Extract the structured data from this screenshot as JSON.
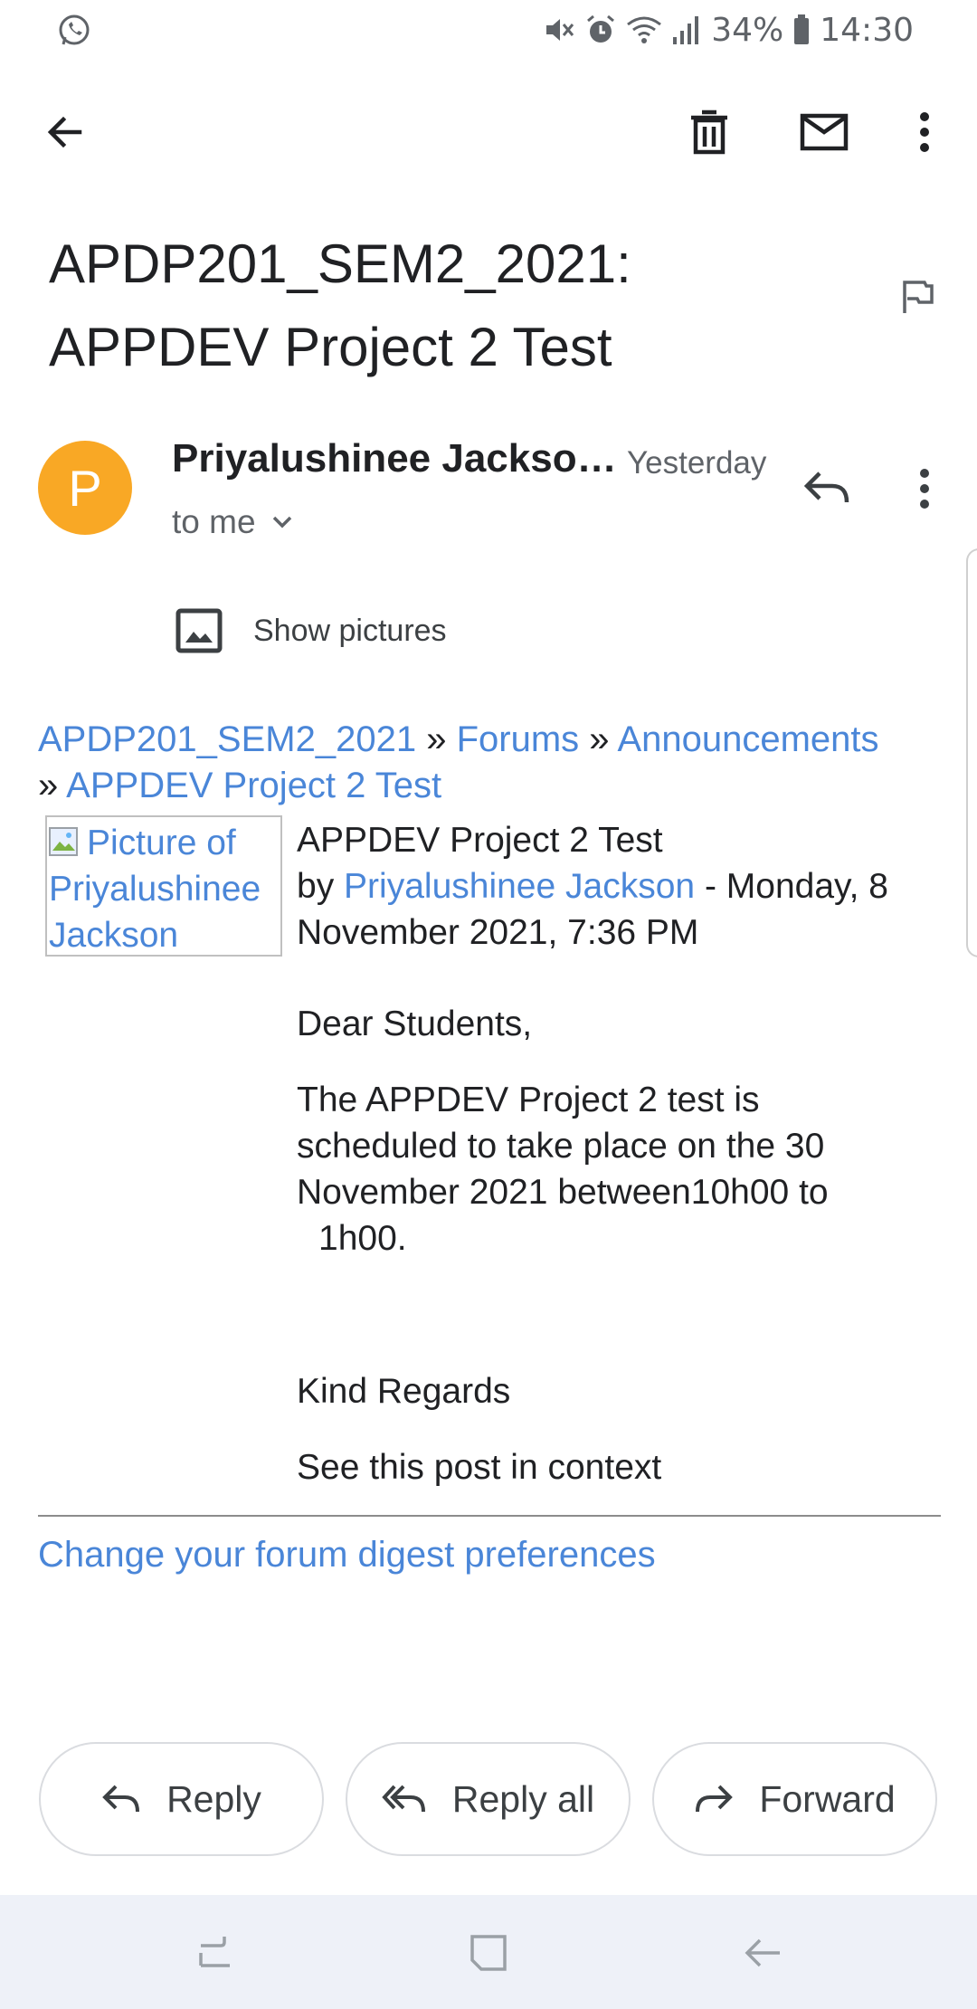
{
  "status": {
    "battery": "34%",
    "time": "14:30"
  },
  "email": {
    "subject": "APDP201_SEM2_2021: APPDEV Project 2 Test",
    "sender_initial": "P",
    "sender": "Priyalushinee Jackso…",
    "date": "Yesterday",
    "recipient": "to me",
    "show_pictures": "Show pictures"
  },
  "breadcrumb": {
    "course": "APDP201_SEM2_2021",
    "sep": "»",
    "forums": "Forums",
    "announcements": "Announcements",
    "topic": "APPDEV Project 2 Test"
  },
  "post": {
    "image_alt": "Picture of Priyalushinee Jackson",
    "title": "APPDEV Project 2 Test",
    "by": "by",
    "author": "Priyalushinee Jackson",
    "datetime": "- Monday, 8 November 2021, 7:36 PM",
    "greeting": "Dear Students,",
    "message": "The APPDEV Project 2 test is scheduled to take place on the 30 November 2021 between10h00 to",
    "message_tail": "1h00.",
    "closing": "Kind Regards",
    "context_link": "See this post in context",
    "prefs_link": "Change your forum digest preferences"
  },
  "actions": {
    "reply": "Reply",
    "reply_all": "Reply all",
    "forward": "Forward"
  },
  "colors": {
    "link": "#4a86d8",
    "avatar": "#f9a825"
  }
}
